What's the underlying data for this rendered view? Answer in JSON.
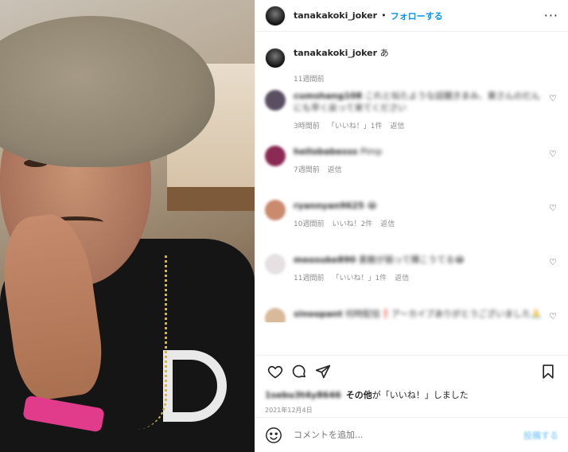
{
  "header": {
    "username": "tanakakoki_joker",
    "separator": "•",
    "follow_label": "フォローする",
    "more_label": "···"
  },
  "caption": {
    "username": "tanakakoki_joker",
    "text": "あ",
    "time": "11週間前"
  },
  "comments": [
    {
      "username": "cumshang108",
      "text": "これと似たような話聞きまみ、東さんのだんにも早く戻って来てください",
      "time": "3時間前",
      "likes": "「いいね！」1件",
      "reply": "返信",
      "avatar_color": "#5a4f62"
    },
    {
      "username": "hellobabesss",
      "text": "Pimp",
      "time": "7週間前",
      "likes": "",
      "reply": "返信",
      "avatar_color": "#8a2a55"
    },
    {
      "username": "ryannyan9625",
      "text": "😂",
      "time": "10週間前",
      "likes": "いいね！2件",
      "reply": "返信",
      "avatar_color": "#c98a6e"
    },
    {
      "username": "meosuke890",
      "text": "素敵が揃って輝こうてる😂",
      "time": "11週間前",
      "likes": "「いいね！」1件",
      "reply": "返信",
      "avatar_color": "#e6e0e3"
    },
    {
      "username": "sinoopant",
      "text": "何時配信❗️アーカイブありがとうございました🙏 ~",
      "time": "",
      "likes": "",
      "reply": "",
      "avatar_color": "#d8b99a"
    }
  ],
  "likes": {
    "user": "1sebu3t4y8646",
    "others": "その他",
    "suffix": "が「いいね！」しました"
  },
  "date": "2021年12月4日",
  "add_comment": {
    "placeholder": "コメントを追加...",
    "post_label": "投稿する"
  },
  "colors": {
    "accent": "#0095f6",
    "text": "#262626",
    "muted": "#8e8e8e"
  },
  "icons": [
    "heart-icon",
    "comment-icon",
    "share-icon",
    "bookmark-icon",
    "emoji-icon",
    "more-icon"
  ]
}
